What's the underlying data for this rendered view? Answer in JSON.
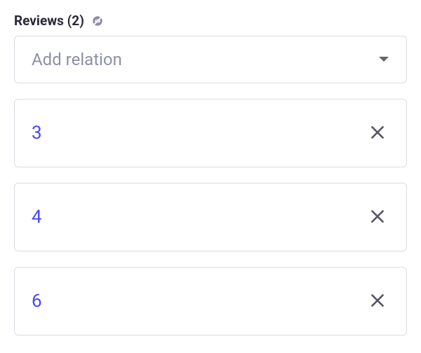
{
  "section": {
    "title": "Reviews (2)"
  },
  "addRelation": {
    "placeholder": "Add relation"
  },
  "relations": [
    {
      "id": "3"
    },
    {
      "id": "4"
    },
    {
      "id": "6"
    }
  ]
}
